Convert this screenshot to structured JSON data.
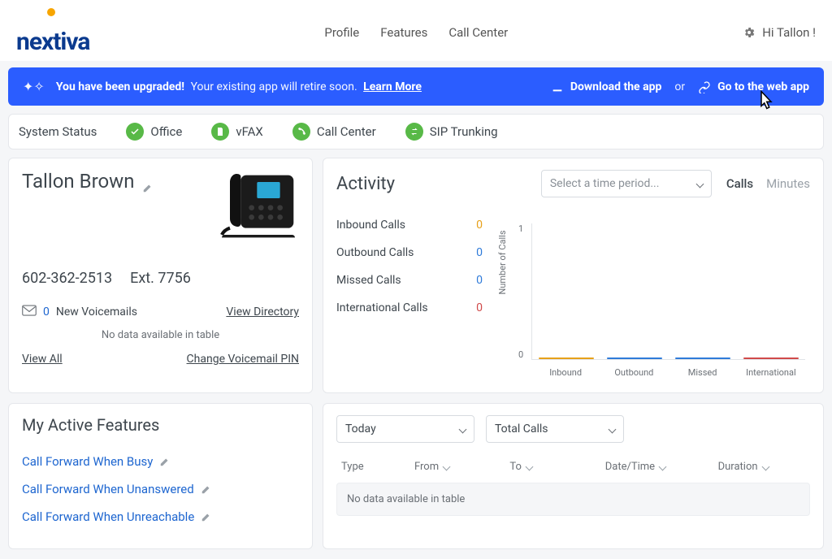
{
  "header": {
    "brand": "nextiva",
    "nav": {
      "profile": "Profile",
      "features": "Features",
      "callcenter": "Call Center"
    },
    "greeting": "Hi Tallon !"
  },
  "banner": {
    "title": "You have been upgraded!",
    "subtitle": "Your existing app will retire soon.",
    "learn_more": "Learn More",
    "download": "Download the app",
    "or": "or",
    "webapp": "Go to the web app"
  },
  "status": {
    "system": "System Status",
    "office": "Office",
    "vfax": "vFAX",
    "callcenter": "Call Center",
    "sip": "SIP Trunking"
  },
  "user": {
    "name": "Tallon Brown",
    "phone": "602-362-2513",
    "ext": "Ext. 7756",
    "voicemail_count": "0",
    "voicemail_label": "New Voicemails",
    "view_directory": "View Directory",
    "no_data": "No data available in table",
    "view_all": "View All",
    "change_pin": "Change Voicemail PIN"
  },
  "activity": {
    "title": "Activity",
    "period_placeholder": "Select a time period...",
    "tab_calls": "Calls",
    "tab_minutes": "Minutes",
    "metrics": {
      "inbound_label": "Inbound Calls",
      "inbound_value": "0",
      "outbound_label": "Outbound Calls",
      "outbound_value": "0",
      "missed_label": "Missed Calls",
      "missed_value": "0",
      "intl_label": "International Calls",
      "intl_value": "0"
    }
  },
  "chart_data": {
    "type": "bar",
    "title": "",
    "xlabel": "",
    "ylabel": "Number of Calls",
    "categories": [
      "Inbound",
      "Outbound",
      "Missed",
      "International"
    ],
    "values": [
      0,
      0,
      0,
      0
    ],
    "ylim": [
      0,
      1
    ],
    "yticks": [
      "1",
      "0"
    ]
  },
  "features": {
    "title": "My Active Features",
    "items": [
      "Call Forward When Busy",
      "Call Forward When Unanswered",
      "Call Forward When Unreachable"
    ]
  },
  "calls": {
    "range": "Today",
    "metric": "Total Calls",
    "columns": {
      "type": "Type",
      "from": "From",
      "to": "To",
      "datetime": "Date/Time",
      "duration": "Duration"
    },
    "empty": "No data available in table"
  }
}
